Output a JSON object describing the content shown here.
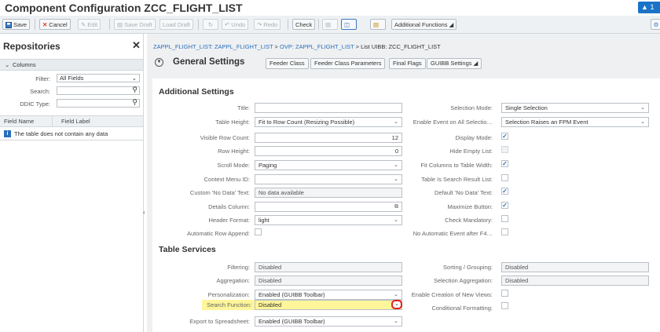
{
  "title": "Component Configuration ZCC_FLIGHT_LIST",
  "notification": {
    "count": "1",
    "icon": "warning-icon"
  },
  "toolbar": {
    "save": "Save",
    "cancel": "Cancel",
    "edit": "Edit",
    "save_draft": "Save Draft",
    "load_draft": "Load Draft",
    "undo": "Undo",
    "redo": "Redo",
    "check": "Check",
    "additional_functions": "Additional Functions"
  },
  "repositories": {
    "title": "Repositories",
    "columns_header": "Columns",
    "filter_label": "Filter:",
    "filter_value": "All Fields",
    "search_label": "Search:",
    "search_value": "",
    "ddic_label": "DDIC Type:",
    "ddic_value": "",
    "col_field_name": "Field Name",
    "col_field_label": "Field Label",
    "empty_text": "The table does not contain any data"
  },
  "breadcrumb": {
    "part1": "ZAPPL_FLIGHT_LIST: ZAPPL_FLIGHT_LIST",
    "part2": "OVP: ZAPPL_FLIGHT_LIST",
    "part3": "List UIBB: ZCC_FLIGHT_LIST",
    "sep": ">"
  },
  "general_settings": {
    "title": "General Settings",
    "buttons": [
      "Feeder Class",
      "Feeder Class Parameters",
      "Final Flags",
      "GUIBB Settings"
    ]
  },
  "additional_settings": {
    "title": "Additional Settings",
    "left": [
      {
        "label": "Title:",
        "value": ""
      },
      {
        "label": "Table Height:",
        "value": "Fit to Row Count (Resizing Possible)"
      },
      {
        "label": "Visible Row Count:",
        "value": "12"
      },
      {
        "label": "Row Height:",
        "value": "0"
      },
      {
        "label": "Scroll Mode:",
        "value": "Paging"
      },
      {
        "label": "Context Menu ID:",
        "value": ""
      },
      {
        "label": "Custom 'No Data' Text:",
        "value": "No data available"
      },
      {
        "label": "Details Column:",
        "value": ""
      },
      {
        "label": "Header Format:",
        "value": "light"
      },
      {
        "label": "Automatic Row Append:",
        "value": ""
      }
    ],
    "right": [
      {
        "label": "Selection Mode:",
        "value": "Single Selection"
      },
      {
        "label": "Enable Event on All Selectio…",
        "value": "Selection Raises an FPM Event"
      },
      {
        "label": "Display Mode:",
        "value": "checked"
      },
      {
        "label": "Hide Empty List:",
        "value": "disabled"
      },
      {
        "label": "Fit Columns to Table Width:",
        "value": "checked"
      },
      {
        "label": "Table Is Search Result List:",
        "value": "unchecked"
      },
      {
        "label": "Default 'No Data' Text:",
        "value": "checked"
      },
      {
        "label": "Maximize Button:",
        "value": "checked"
      },
      {
        "label": "Check Mandatory:",
        "value": "unchecked"
      },
      {
        "label": "No Automatic Event after F4…",
        "value": "unchecked"
      }
    ]
  },
  "table_services": {
    "title": "Table Services",
    "left": [
      {
        "label": "Filtering:",
        "value": "Disabled"
      },
      {
        "label": "Aggregation:",
        "value": "Disabled"
      },
      {
        "label": "Personalization:",
        "value": "Enabled (GUIBB Toolbar)"
      },
      {
        "label": "Search Function:",
        "value": "Disabled"
      },
      {
        "label": "Export to Spreadsheet:",
        "value": "Enabled (GUIBB Toolbar)"
      }
    ],
    "right": [
      {
        "label": "Sorting / Grouping:",
        "value": "Disabled"
      },
      {
        "label": "Selection Aggregation:",
        "value": "Disabled"
      },
      {
        "label": "Enable Creation of New Views:",
        "value": "unchecked"
      },
      {
        "label": "Conditional Formatting:",
        "value": "unchecked"
      }
    ]
  },
  "colors": {
    "accent": "#2a6ebb",
    "highlight": "#fff59a",
    "annotation": "#e02020"
  }
}
